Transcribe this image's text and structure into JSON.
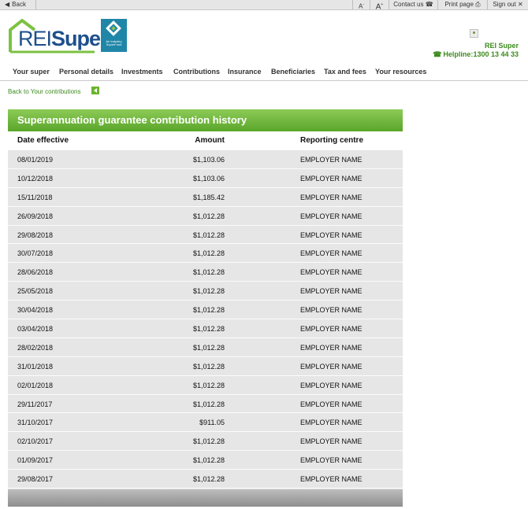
{
  "toolbar": {
    "back": "Back",
    "font_small": "A",
    "font_large": "A",
    "contact": "Contact us",
    "print": "Print page",
    "signout": "Sign out"
  },
  "header": {
    "logo_text_a": "REI",
    "logo_text_b": "Super",
    "badge_text": "An Industry SuperFund",
    "brand": "REI Super",
    "helpline_label": "Helpline:",
    "helpline_number": "1300 13 44 33"
  },
  "nav": [
    "Your super",
    "Personal details",
    "Investments",
    "Contributions",
    "Insurance",
    "Beneficiaries",
    "Tax and fees",
    "Your resources"
  ],
  "back_link": "Back to Your contributions",
  "table": {
    "title": "Superannuation guarantee contribution history",
    "columns": [
      "Date effective",
      "Amount",
      "Reporting centre"
    ],
    "rows": [
      [
        "08/01/2019",
        "$1,103.06",
        "EMPLOYER NAME"
      ],
      [
        "10/12/2018",
        "$1,103.06",
        "EMPLOYER NAME"
      ],
      [
        "15/11/2018",
        "$1,185.42",
        "EMPLOYER NAME"
      ],
      [
        "26/09/2018",
        "$1,012.28",
        "EMPLOYER NAME"
      ],
      [
        "29/08/2018",
        "$1,012.28",
        "EMPLOYER NAME"
      ],
      [
        "30/07/2018",
        "$1,012.28",
        "EMPLOYER NAME"
      ],
      [
        "28/06/2018",
        "$1,012.28",
        "EMPLOYER NAME"
      ],
      [
        "25/05/2018",
        "$1,012.28",
        "EMPLOYER NAME"
      ],
      [
        "30/04/2018",
        "$1,012.28",
        "EMPLOYER NAME"
      ],
      [
        "03/04/2018",
        "$1,012.28",
        "EMPLOYER NAME"
      ],
      [
        "28/02/2018",
        "$1,012.28",
        "EMPLOYER NAME"
      ],
      [
        "31/01/2018",
        "$1,012.28",
        "EMPLOYER NAME"
      ],
      [
        "02/01/2018",
        "$1,012.28",
        "EMPLOYER NAME"
      ],
      [
        "29/11/2017",
        "$1,012.28",
        "EMPLOYER NAME"
      ],
      [
        "31/10/2017",
        "$911.05",
        "EMPLOYER NAME"
      ],
      [
        "02/10/2017",
        "$1,012.28",
        "EMPLOYER NAME"
      ],
      [
        "01/09/2017",
        "$1,012.28",
        "EMPLOYER NAME"
      ],
      [
        "29/08/2017",
        "$1,012.28",
        "EMPLOYER NAME"
      ]
    ]
  },
  "colors": {
    "brand_green": "#3d8b1e",
    "header_green": "#6bb42e",
    "logo_blue": "#1e4f8c",
    "badge_blue": "#1f86a8"
  }
}
